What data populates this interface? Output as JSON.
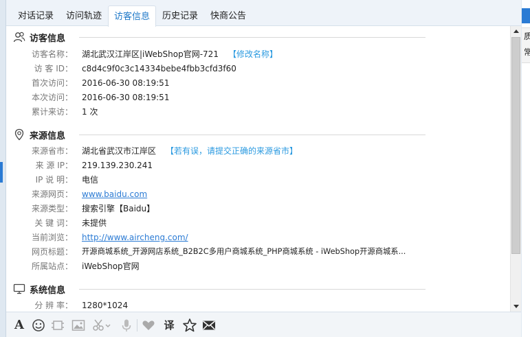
{
  "tabs": [
    "对话记录",
    "访问轨迹",
    "访客信息",
    "历史记录",
    "快商公告"
  ],
  "active_tab": "访客信息",
  "visitor_section": {
    "title": "访客信息",
    "rows": [
      {
        "label": "访客名称：",
        "value": "湖北武汉江岸区|iWebShop官网-721",
        "action": "【修改名称】"
      },
      {
        "label": "访 客 ID：",
        "value": "c8d4c9f0c3c14334bebe4fbb3cfd3f60"
      },
      {
        "label": "首次访问：",
        "value": "2016-06-30 08:19:51"
      },
      {
        "label": "本次访问：",
        "value": "2016-06-30 08:19:51"
      },
      {
        "label": "累计来访：",
        "value": "1 次"
      }
    ]
  },
  "source_section": {
    "title": "来源信息",
    "rows": [
      {
        "label": "来源省市：",
        "value": "湖北省武汉市江岸区",
        "action": "【若有误，请提交正确的来源省市】"
      },
      {
        "label": "来 源 IP：",
        "value": "219.139.230.241"
      },
      {
        "label": "IP 说 明：",
        "value": "电信"
      },
      {
        "label": "来源网页：",
        "value": "www.baidu.com"
      },
      {
        "label": "来源类型：",
        "value": "搜索引擎【Baidu】"
      },
      {
        "label": "关 键 词：",
        "value": "未提供"
      },
      {
        "label": "当前浏览：",
        "value": "http://www.aircheng.com/"
      },
      {
        "label": "网页标题：",
        "value": "开源商城系统_开源网店系统_B2B2C多用户商城系统_PHP商城系统 - iWebShop开源商城系..."
      },
      {
        "label": "所属站点：",
        "value": "iWebShop官网"
      }
    ]
  },
  "system_section": {
    "title": "系统信息",
    "rows": [
      {
        "label": "分 辨 率：",
        "value": "1280*1024"
      }
    ]
  },
  "toolbar_icons": [
    "font-icon",
    "emoji-icon",
    "screenshot-icon",
    "image-icon",
    "scissors-icon",
    "microphone-icon",
    "heart-icon",
    "translate-icon",
    "star-icon",
    "mail-icon"
  ],
  "toolbar_translate_label": "译",
  "toolbar_font_label": "A",
  "right_strip": {
    "line1": "质",
    "line2": "常"
  },
  "colors": {
    "accent": "#2b7bd4",
    "link": "#2b7bd4",
    "hint": "#2b9ae0",
    "label": "#777777"
  }
}
